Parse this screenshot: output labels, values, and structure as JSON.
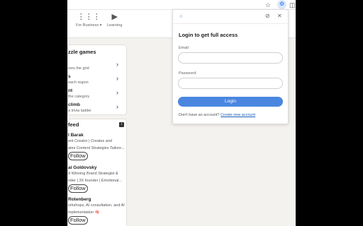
{
  "browser": {
    "bookmark_icon": "star-icon",
    "extension_icon": "extension-icon",
    "puzzle_icon": "puzzle-icon"
  },
  "nav": {
    "items": [
      {
        "label": "For Business ▾",
        "icon": "grid-icon"
      },
      {
        "label": "Learning",
        "icon": "play-icon"
      }
    ]
  },
  "games": {
    "heading": "zzle games",
    "items": [
      {
        "title": "",
        "subtitle": "izes the grid"
      },
      {
        "title": "s",
        "subtitle": "each region"
      },
      {
        "title": "nt",
        "subtitle": "the category"
      },
      {
        "title": "climb",
        "subtitle": "a trivia ladder"
      }
    ]
  },
  "feed": {
    "heading": "feed",
    "people": [
      {
        "name": "l Barak",
        "desc": [
          "ent Creator | Creates and",
          "ates Content Strategies Tailore..."
        ],
        "follow": "Follow"
      },
      {
        "name": "ai Goldovsky",
        "desc": [
          "d Winning Brand Strategist &",
          "nder | 3X founder | Emotional..."
        ],
        "follow": "Follow"
      },
      {
        "name": "Rotenberg",
        "desc": [
          "orkshops, AI consultation, and AI",
          "mplementation 🧠"
        ],
        "follow": "Follow"
      }
    ]
  },
  "popup": {
    "title": "Login to get full access",
    "email_label": "Email:",
    "email_value": "",
    "password_label": "Password:",
    "password_value": "",
    "login_button": "Login",
    "footer_text": "Don't have an account?",
    "footer_link": "Create new account",
    "accent_color": "#4a86e0"
  }
}
